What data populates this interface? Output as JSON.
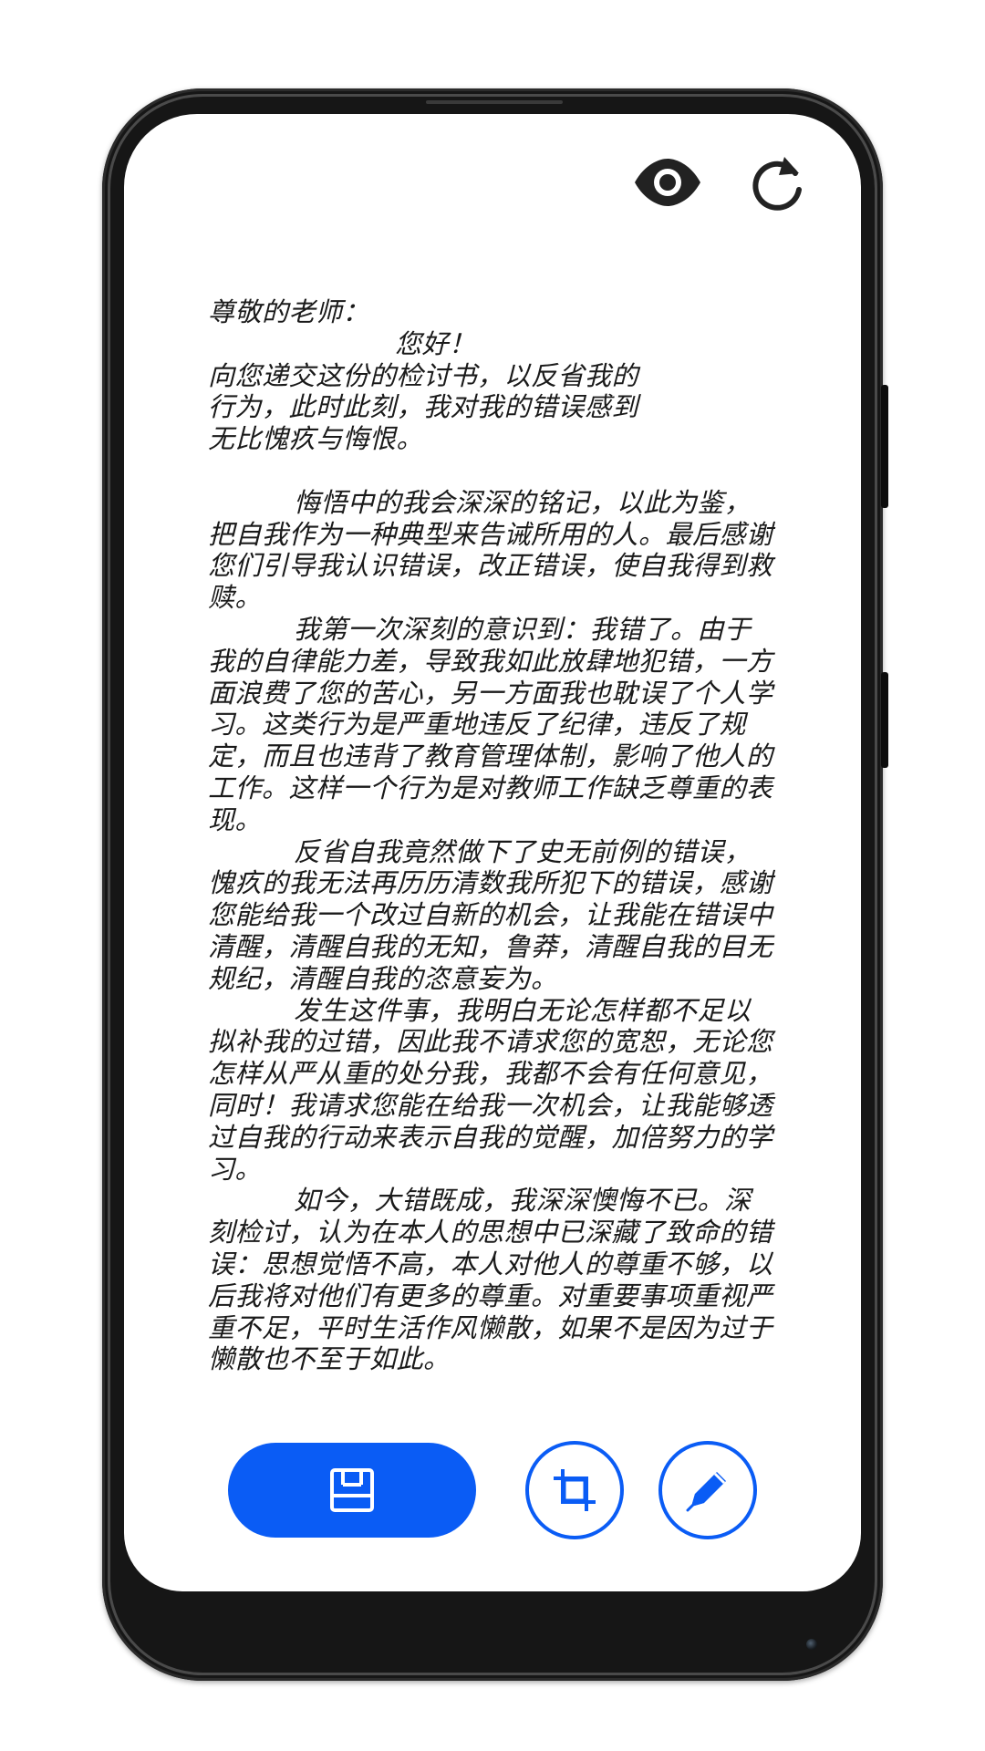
{
  "icons": {
    "preview": "eye-icon",
    "rotate": "rotate-icon",
    "save": "save-icon",
    "crop": "crop-icon",
    "edit": "pencil-icon"
  },
  "colors": {
    "accent": "#0a5cf5",
    "ink": "#1a1a1a",
    "icon": "#222222"
  },
  "letter": {
    "salutation": "尊敬的老师：",
    "greeting": "您好！",
    "intro_lines": [
      "向您递交这份的检讨书，以反省我的",
      "行为，此时此刻，我对我的错误感到",
      "无比愧疚与悔恨。"
    ],
    "paragraphs": [
      "悔悟中的我会深深的铭记，以此为鉴，把自我作为一种典型来告诫所用的人。最后感谢您们引导我认识错误，改正错误，使自我得到救赎。",
      "我第一次深刻的意识到：我错了。由于我的自律能力差，导致我如此放肆地犯错，一方面浪费了您的苦心，另一方面我也耽误了个人学习。这类行为是严重地违反了纪律，违反了规定，而且也违背了教育管理体制，影响了他人的工作。这样一个行为是对教师工作缺乏尊重的表现。",
      "反省自我竟然做下了史无前例的错误，愧疚的我无法再历历清数我所犯下的错误，感谢您能给我一个改过自新的机会，让我能在错误中清醒，清醒自我的无知，鲁莽，清醒自我的目无规纪，清醒自我的恣意妄为。",
      "发生这件事，我明白无论怎样都不足以拟补我的过错，因此我不请求您的宽恕，无论您怎样从严从重的处分我，我都不会有任何意见，同时！我请求您能在给我一次机会，让我能够透过自我的行动来表示自我的觉醒，加倍努力的学习。",
      "如今，大错既成，我深深懊悔不已。深刻检讨，认为在本人的思想中已深藏了致命的错误：思想觉悟不高，本人对他人的尊重不够，以后我将对他们有更多的尊重。对重要事项重视严重不足，平时生活作风懒散，如果不是因为过于懒散也不至于如此。"
    ]
  }
}
